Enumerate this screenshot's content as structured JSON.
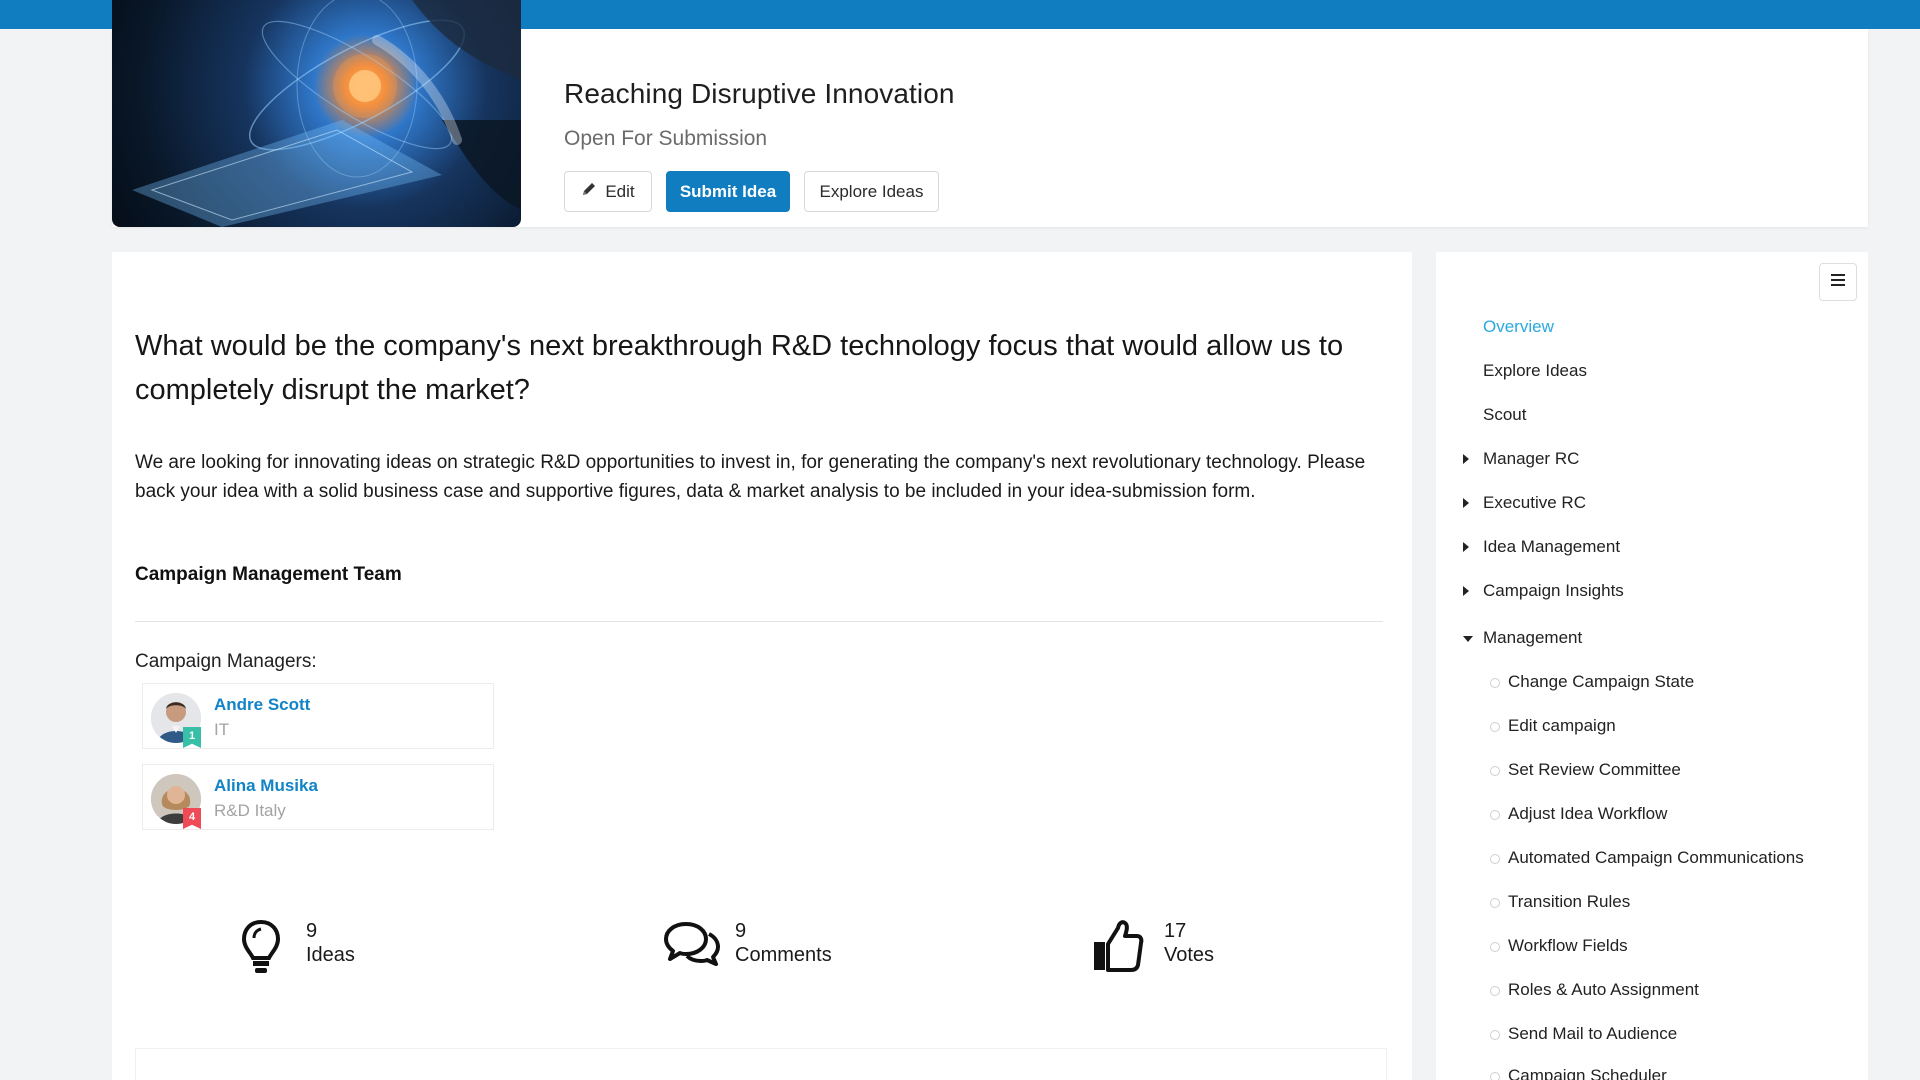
{
  "header": {
    "title": "Reaching Disruptive Innovation",
    "status": "Open For Submission",
    "buttons": {
      "edit": "Edit",
      "submit": "Submit Idea",
      "explore": "Explore Ideas"
    }
  },
  "main": {
    "question": "What would be the company's next breakthrough R&D technology focus that would allow us to completely disrupt the market?",
    "description": "We are looking for innovating ideas on strategic R&D opportunities to invest in, for generating the company's next revolutionary technology. Please back your idea with a solid business case and supportive figures, data & market analysis to be included in your idea-submission form.",
    "team_heading": "Campaign Management Team",
    "managers_label": "Campaign Managers:",
    "managers": [
      {
        "name": "Andre Scott",
        "dept": "IT",
        "badge": "1"
      },
      {
        "name": "Alina Musika",
        "dept": "R&D Italy",
        "badge": "4"
      }
    ],
    "stats": {
      "ideas": {
        "value": "9",
        "label": "Ideas"
      },
      "comments": {
        "value": "9",
        "label": "Comments"
      },
      "votes": {
        "value": "17",
        "label": "Votes"
      }
    }
  },
  "sidebar": {
    "items": [
      {
        "label": "Overview",
        "active": true
      },
      {
        "label": "Explore Ideas"
      },
      {
        "label": "Scout"
      },
      {
        "label": "Manager RC",
        "expandable": true
      },
      {
        "label": "Executive RC",
        "expandable": true
      },
      {
        "label": "Idea Management",
        "expandable": true
      },
      {
        "label": "Campaign Insights",
        "expandable": true
      },
      {
        "label": "Management",
        "expanded": true
      }
    ],
    "management_items": [
      "Change Campaign State",
      "Edit campaign",
      "Set Review Committee",
      "Adjust Idea Workflow",
      "Automated Campaign Communications",
      "Transition Rules",
      "Workflow Fields",
      "Roles & Auto Assignment",
      "Send Mail to Audience",
      "Campaign Scheduler"
    ]
  },
  "colors": {
    "brand": "#0f7dbf",
    "active_nav": "#2aa9e0",
    "link": "#1183c7"
  }
}
